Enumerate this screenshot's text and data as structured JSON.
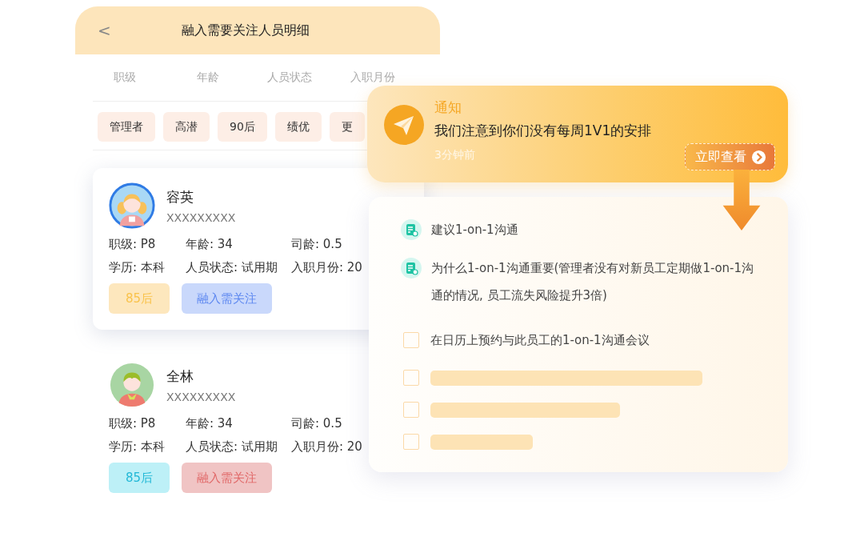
{
  "panel": {
    "back": "<",
    "title": "融入需要关注人员明细",
    "columns": [
      "职级",
      "年龄",
      "人员状态",
      "入职月份"
    ],
    "filters": [
      "管理者",
      "高潜",
      "90后",
      "绩优",
      "更"
    ],
    "people": [
      {
        "name": "容英",
        "id": "XXXXXXXXX",
        "kind": "girl",
        "elevated": true,
        "fields": [
          [
            "职级: P8",
            "年龄: 34",
            "司龄: 0.5"
          ],
          [
            "学历: 本科",
            "人员状态: 试用期",
            "入职月份: 20"
          ]
        ],
        "tags": [
          {
            "text": "85后",
            "color": "#fde7bd"
          },
          {
            "text": "融入需关注",
            "color": "#c9d8fb"
          }
        ]
      },
      {
        "name": "全林",
        "id": "XXXXXXXXX",
        "kind": "boy",
        "elevated": false,
        "fields": [
          [
            "职级: P8",
            "年龄: 34",
            "司龄: 0.5"
          ],
          [
            "学历: 本科",
            "人员状态: 试用期",
            "入职月份: 20"
          ]
        ],
        "tags": [
          {
            "text": "85后",
            "color": "#bdf0f7"
          },
          {
            "text": "融入需关注",
            "color": "#f0c4c4"
          }
        ]
      }
    ]
  },
  "notification": {
    "title": "通知",
    "message": "我们注意到你们没有每周1V1的安排",
    "time": "3分钟前",
    "action": "立即查看"
  },
  "tasks": [
    {
      "kind": "note",
      "text": "建议1-on-1沟通"
    },
    {
      "kind": "note",
      "text": "为什么1-on-1沟通重要(管理者没有对新员工定期做1-on-1沟通的情况, 员工流失风险提升3倍)"
    },
    {
      "kind": "checkbox",
      "checked": false,
      "text": "在日历上预约与此员工的1-on-1沟通会议"
    },
    {
      "kind": "skeleton",
      "checked": false
    },
    {
      "kind": "skeleton",
      "checked": false
    },
    {
      "kind": "skeleton",
      "checked": false
    }
  ]
}
